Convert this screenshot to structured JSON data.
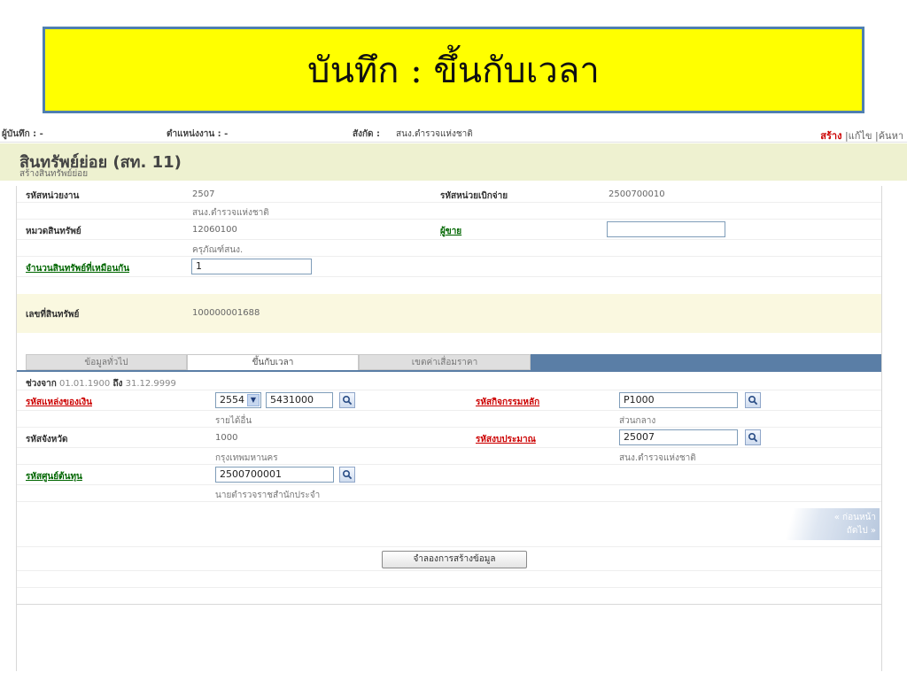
{
  "banner": {
    "title": "บันทึก : ขึ้นกับเวลา"
  },
  "userbar": {
    "recorder_label": "ผู้บันทึก : -",
    "position_label": "ตำแหน่งงาน : -",
    "affiliation_label": "สังกัด :",
    "affiliation_value": "สนง.ตำรวจแห่งชาติ",
    "actions": {
      "create": "สร้าง",
      "edit": "แก้ไข",
      "search": "ค้นหา"
    }
  },
  "header": {
    "title": "สินทรัพย์ย่อย (สท. 11)",
    "subtitle": "สร้างสินทรัพย์ย่อย"
  },
  "form": {
    "agency_code_label": "รหัสหน่วยงาน",
    "agency_code_value": "2507",
    "agency_name": "สนง.ตำรวจแห่งชาติ",
    "disburse_code_label": "รหัสหน่วยเบิกจ่าย",
    "disburse_code_value": "2500700010",
    "asset_category_label": "หมวดสินทรัพย์",
    "asset_category_value": "12060100",
    "asset_category_name": "ครุภัณฑ์สนง.",
    "seller_label": "ผู้ขาย",
    "seller_value": "",
    "same_asset_count_label": "จำนวนสินทรัพย์ที่เหมือนกัน",
    "same_asset_count_value": "1",
    "asset_number_label": "เลขที่สินทรัพย์",
    "asset_number_value": "100000001688"
  },
  "tabs": [
    {
      "label": "ข้อมูลทั่วไป",
      "active": false
    },
    {
      "label": "ขึ้นกับเวลา",
      "active": true
    },
    {
      "label": "เขตค่าเสื่อมราคา",
      "active": false
    }
  ],
  "period": {
    "from_label": "ช่วงจาก",
    "from_value": "01.01.1900",
    "to_label": "ถึง",
    "to_value": "31.12.9999"
  },
  "time_dependent": {
    "fund_source_label": "รหัสแหล่งของเงิน",
    "fund_year_value": "2554",
    "fund_source_value": "5431000",
    "fund_source_name": "รายได้อื่น",
    "main_activity_label": "รหัสกิจกรรมหลัก",
    "main_activity_value": "P1000",
    "main_activity_name": "ส่วนกลาง",
    "province_label": "รหัสจังหวัด",
    "province_value": "1000",
    "province_name": "กรุงเทพมหานคร",
    "budget_label": "รหัสงบประมาณ",
    "budget_value": "25007",
    "budget_name": "สนง.ตำรวจแห่งชาติ",
    "cost_center_label": "รหัสศูนย์ต้นทุน",
    "cost_center_value": "2500700001",
    "cost_center_name": "นายตำรวจราชสำนักประจำ"
  },
  "nav": {
    "prev": "« ก่อนหน้า",
    "next": "ถัดไป »"
  },
  "simulate_button": "จำลองการสร้างข้อมูล",
  "icons": {
    "search": "magnifier-icon",
    "dropdown": "chevron-down-icon"
  },
  "colors": {
    "banner_bg": "#ffff00",
    "banner_border": "#4f7fb0",
    "header_bg": "#eef1d0",
    "tab_bar": "#5a7ea6",
    "required_link": "#cc0000",
    "link": "#006600"
  }
}
